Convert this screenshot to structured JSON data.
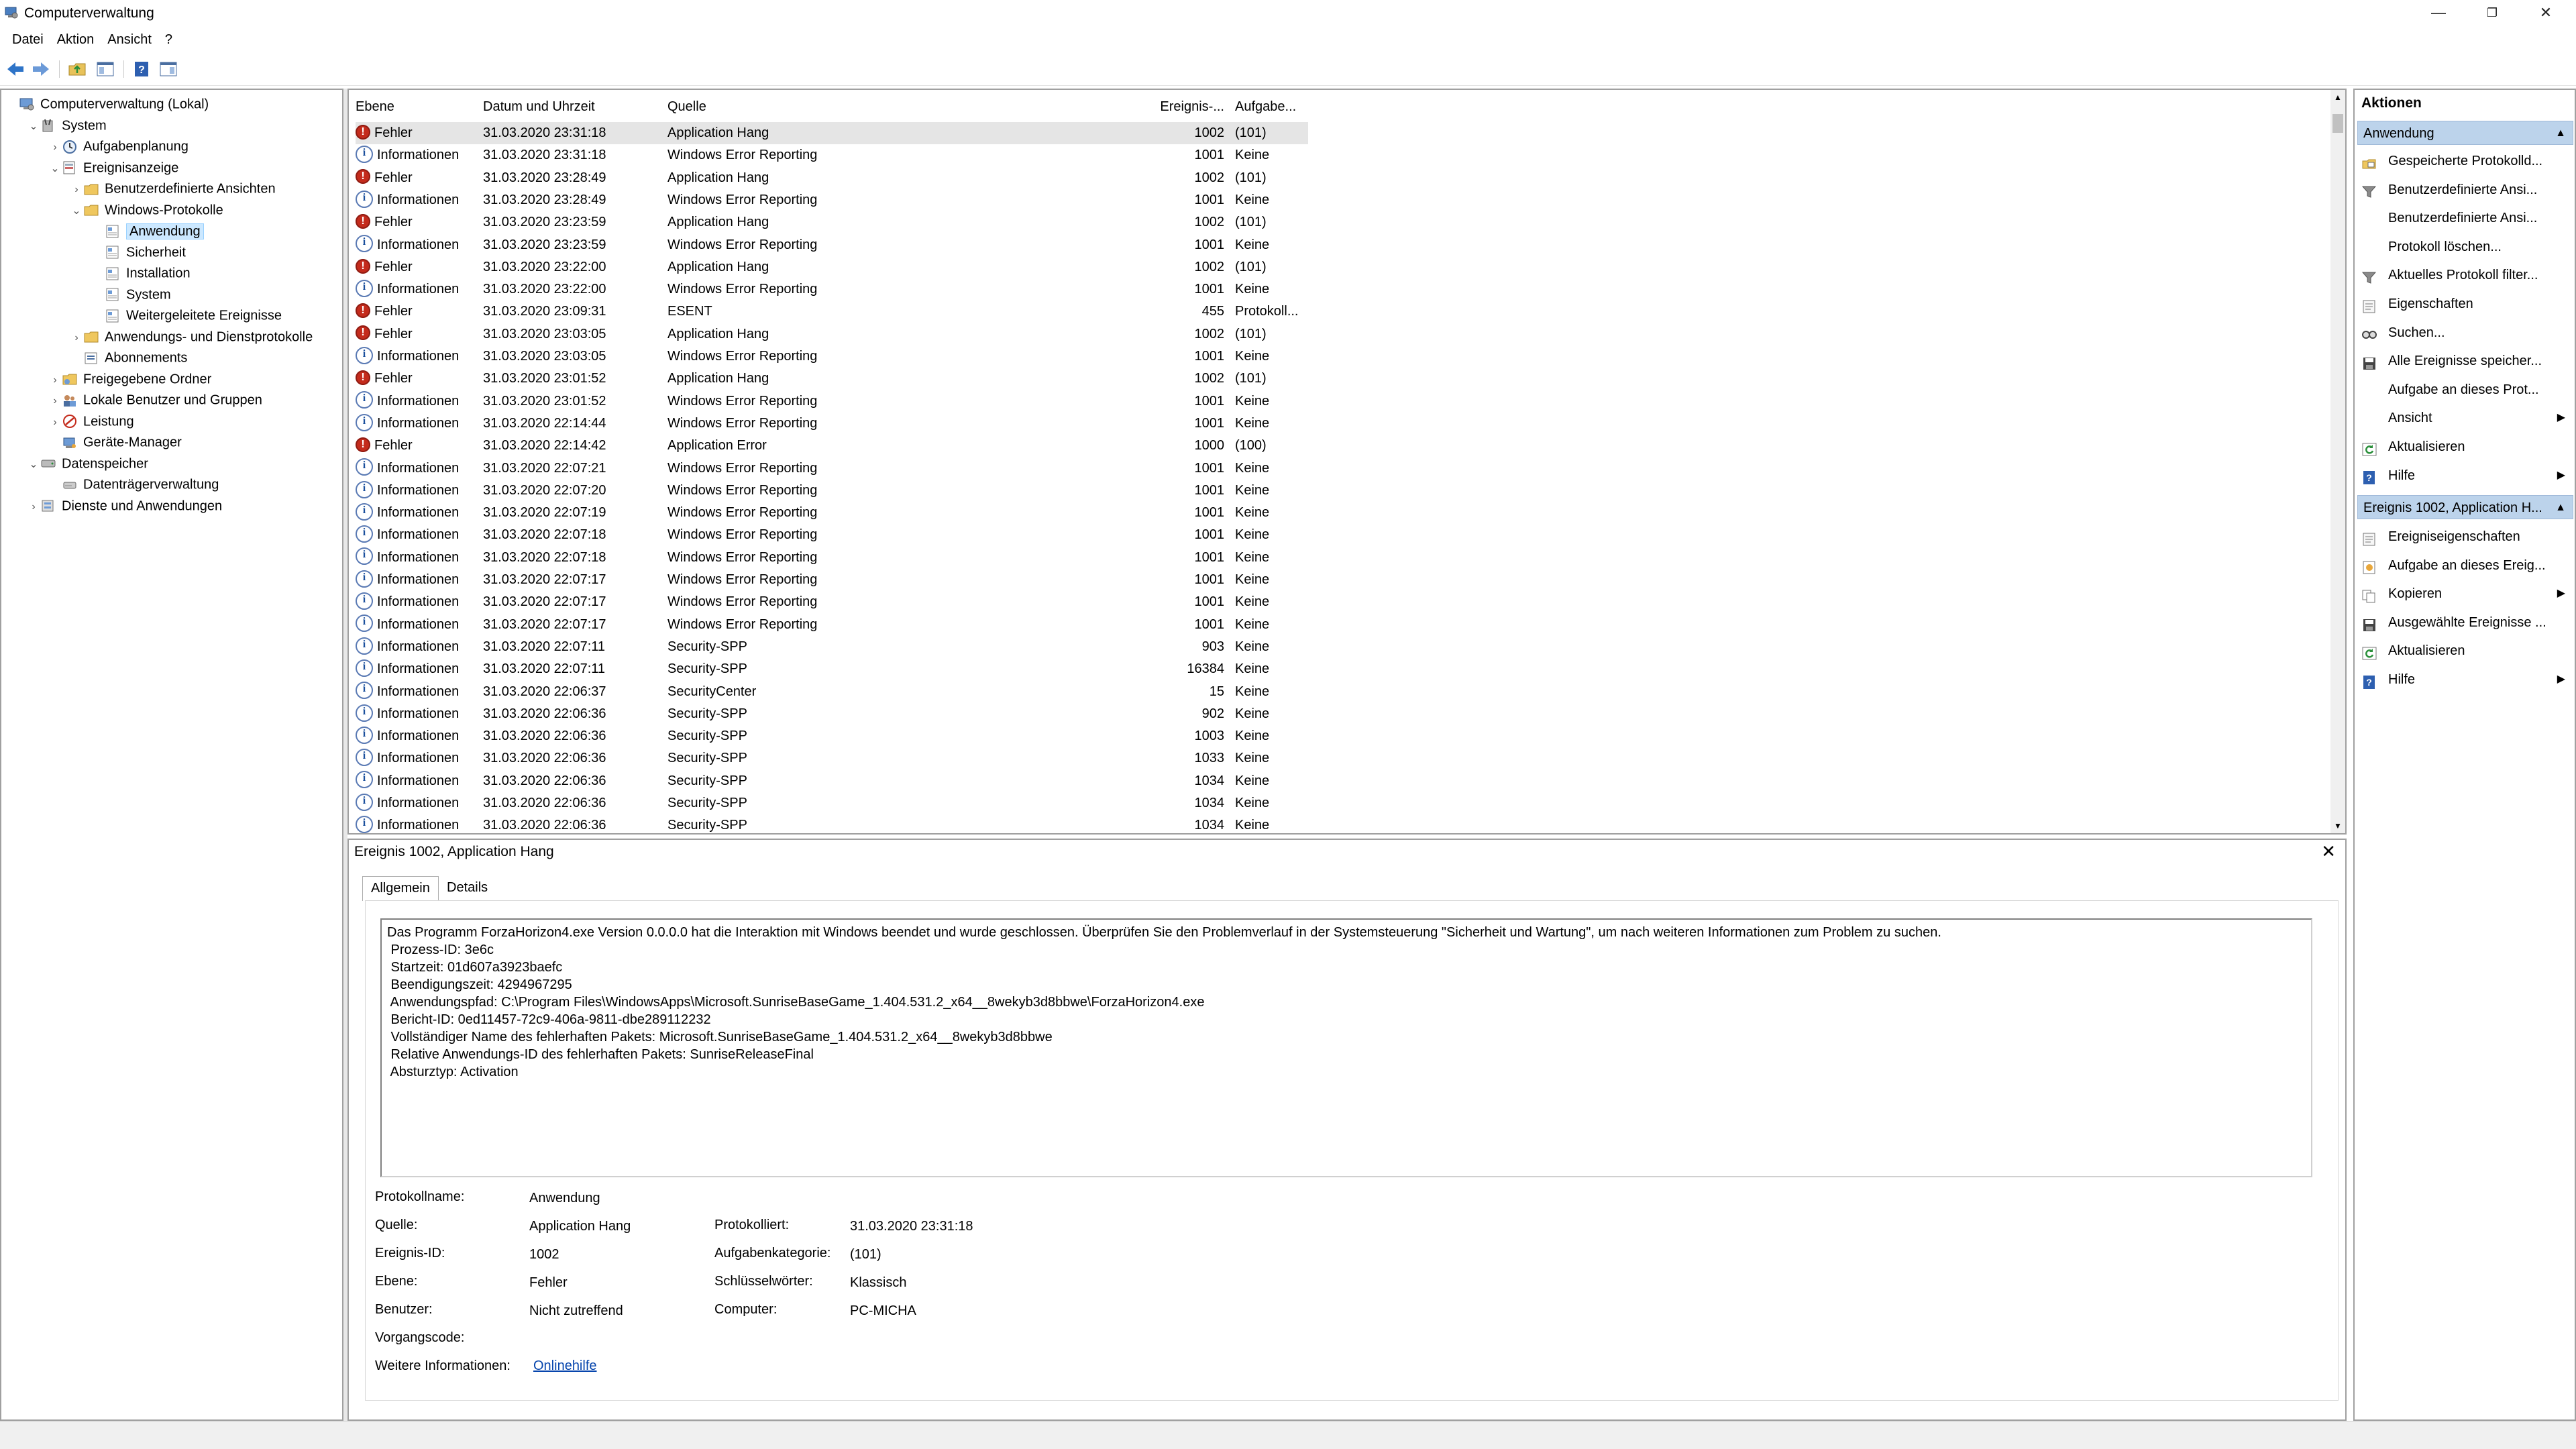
{
  "window": {
    "title": "Computerverwaltung",
    "minimize": "—",
    "restore": "❐",
    "close": "✕"
  },
  "menu": [
    "Datei",
    "Aktion",
    "Ansicht",
    "?"
  ],
  "tree": [
    {
      "label": "Computerverwaltung (Lokal)",
      "exp": "",
      "icon": "computer-icon"
    },
    {
      "label": "System",
      "exp": "⌄",
      "icon": "system-tools-icon"
    },
    {
      "label": "Aufgabenplanung",
      "exp": "›",
      "icon": "clock-icon"
    },
    {
      "label": "Ereignisanzeige",
      "exp": "⌄",
      "icon": "event-viewer-icon"
    },
    {
      "label": "Benutzerdefinierte Ansichten",
      "exp": "›",
      "icon": "folder-icon"
    },
    {
      "label": "Windows-Protokolle",
      "exp": "⌄",
      "icon": "folder-icon"
    },
    {
      "label": "Anwendung",
      "exp": "",
      "icon": "log-icon",
      "selected": true
    },
    {
      "label": "Sicherheit",
      "exp": "",
      "icon": "log-icon"
    },
    {
      "label": "Installation",
      "exp": "",
      "icon": "log-icon"
    },
    {
      "label": "System",
      "exp": "",
      "icon": "log-icon"
    },
    {
      "label": "Weitergeleitete Ereignisse",
      "exp": "",
      "icon": "log-icon"
    },
    {
      "label": "Anwendungs- und Dienstprotokolle",
      "exp": "›",
      "icon": "folder-icon"
    },
    {
      "label": "Abonnements",
      "exp": "",
      "icon": "subscription-icon"
    },
    {
      "label": "Freigegebene Ordner",
      "exp": "›",
      "icon": "shared-folder-icon"
    },
    {
      "label": "Lokale Benutzer und Gruppen",
      "exp": "›",
      "icon": "users-icon"
    },
    {
      "label": "Leistung",
      "exp": "›",
      "icon": "performance-icon"
    },
    {
      "label": "Geräte-Manager",
      "exp": "",
      "icon": "device-manager-icon"
    },
    {
      "label": "Datenspeicher",
      "exp": "⌄",
      "icon": "storage-icon"
    },
    {
      "label": "Datenträgerverwaltung",
      "exp": "",
      "icon": "disk-icon"
    },
    {
      "label": "Dienste und Anwendungen",
      "exp": "›",
      "icon": "services-icon"
    }
  ],
  "list": {
    "headers": [
      "Ebene",
      "Datum und Uhrzeit",
      "Quelle",
      "Ereignis-...",
      "Aufgabe..."
    ],
    "rows": [
      [
        "err",
        "Fehler",
        "31.03.2020 23:31:18",
        "Application Hang",
        "1002",
        "(101)"
      ],
      [
        "info",
        "Informationen",
        "31.03.2020 23:31:18",
        "Windows Error Reporting",
        "1001",
        "Keine"
      ],
      [
        "err",
        "Fehler",
        "31.03.2020 23:28:49",
        "Application Hang",
        "1002",
        "(101)"
      ],
      [
        "info",
        "Informationen",
        "31.03.2020 23:28:49",
        "Windows Error Reporting",
        "1001",
        "Keine"
      ],
      [
        "err",
        "Fehler",
        "31.03.2020 23:23:59",
        "Application Hang",
        "1002",
        "(101)"
      ],
      [
        "info",
        "Informationen",
        "31.03.2020 23:23:59",
        "Windows Error Reporting",
        "1001",
        "Keine"
      ],
      [
        "err",
        "Fehler",
        "31.03.2020 23:22:00",
        "Application Hang",
        "1002",
        "(101)"
      ],
      [
        "info",
        "Informationen",
        "31.03.2020 23:22:00",
        "Windows Error Reporting",
        "1001",
        "Keine"
      ],
      [
        "err",
        "Fehler",
        "31.03.2020 23:09:31",
        "ESENT",
        "455",
        "Protokoll..."
      ],
      [
        "err",
        "Fehler",
        "31.03.2020 23:03:05",
        "Application Hang",
        "1002",
        "(101)"
      ],
      [
        "info",
        "Informationen",
        "31.03.2020 23:03:05",
        "Windows Error Reporting",
        "1001",
        "Keine"
      ],
      [
        "err",
        "Fehler",
        "31.03.2020 23:01:52",
        "Application Hang",
        "1002",
        "(101)"
      ],
      [
        "info",
        "Informationen",
        "31.03.2020 23:01:52",
        "Windows Error Reporting",
        "1001",
        "Keine"
      ],
      [
        "info",
        "Informationen",
        "31.03.2020 22:14:44",
        "Windows Error Reporting",
        "1001",
        "Keine"
      ],
      [
        "err",
        "Fehler",
        "31.03.2020 22:14:42",
        "Application Error",
        "1000",
        "(100)"
      ],
      [
        "info",
        "Informationen",
        "31.03.2020 22:07:21",
        "Windows Error Reporting",
        "1001",
        "Keine"
      ],
      [
        "info",
        "Informationen",
        "31.03.2020 22:07:20",
        "Windows Error Reporting",
        "1001",
        "Keine"
      ],
      [
        "info",
        "Informationen",
        "31.03.2020 22:07:19",
        "Windows Error Reporting",
        "1001",
        "Keine"
      ],
      [
        "info",
        "Informationen",
        "31.03.2020 22:07:18",
        "Windows Error Reporting",
        "1001",
        "Keine"
      ],
      [
        "info",
        "Informationen",
        "31.03.2020 22:07:18",
        "Windows Error Reporting",
        "1001",
        "Keine"
      ],
      [
        "info",
        "Informationen",
        "31.03.2020 22:07:17",
        "Windows Error Reporting",
        "1001",
        "Keine"
      ],
      [
        "info",
        "Informationen",
        "31.03.2020 22:07:17",
        "Windows Error Reporting",
        "1001",
        "Keine"
      ],
      [
        "info",
        "Informationen",
        "31.03.2020 22:07:17",
        "Windows Error Reporting",
        "1001",
        "Keine"
      ],
      [
        "info",
        "Informationen",
        "31.03.2020 22:07:11",
        "Security-SPP",
        "903",
        "Keine"
      ],
      [
        "info",
        "Informationen",
        "31.03.2020 22:07:11",
        "Security-SPP",
        "16384",
        "Keine"
      ],
      [
        "info",
        "Informationen",
        "31.03.2020 22:06:37",
        "SecurityCenter",
        "15",
        "Keine"
      ],
      [
        "info",
        "Informationen",
        "31.03.2020 22:06:36",
        "Security-SPP",
        "902",
        "Keine"
      ],
      [
        "info",
        "Informationen",
        "31.03.2020 22:06:36",
        "Security-SPP",
        "1003",
        "Keine"
      ],
      [
        "info",
        "Informationen",
        "31.03.2020 22:06:36",
        "Security-SPP",
        "1033",
        "Keine"
      ],
      [
        "info",
        "Informationen",
        "31.03.2020 22:06:36",
        "Security-SPP",
        "1034",
        "Keine"
      ],
      [
        "info",
        "Informationen",
        "31.03.2020 22:06:36",
        "Security-SPP",
        "1034",
        "Keine"
      ],
      [
        "info",
        "Informationen",
        "31.03.2020 22:06:36",
        "Security-SPP",
        "1034",
        "Keine"
      ]
    ]
  },
  "detail": {
    "title": "Ereignis 1002, Application Hang",
    "close": "✕",
    "tabs": [
      "Allgemein",
      "Details"
    ],
    "description": "Das Programm ForzaHorizon4.exe Version 0.0.0.0 hat die Interaktion mit Windows beendet und wurde geschlossen. Überprüfen Sie den Problemverlauf in der Systemsteuerung \"Sicherheit und Wartung\", um nach weiteren Informationen zum Problem zu suchen.\n Prozess-ID: 3e6c\n Startzeit: 01d607a3923baefc\n Beendigungszeit: 4294967295\n Anwendungspfad: C:\\Program Files\\WindowsApps\\Microsoft.SunriseBaseGame_1.404.531.2_x64__8wekyb3d8bbwe\\ForzaHorizon4.exe\n Bericht-ID: 0ed11457-72c9-406a-9811-dbe289112232\n Vollständiger Name des fehlerhaften Pakets: Microsoft.SunriseBaseGame_1.404.531.2_x64__8wekyb3d8bbwe\n Relative Anwendungs-ID des fehlerhaften Pakets: SunriseReleaseFinal\n Absturztyp: Activation",
    "props": {
      "protokollname_label": "Protokollname:",
      "protokollname": "Anwendung",
      "quelle_label": "Quelle:",
      "quelle": "Application Hang",
      "protokolliert_label": "Protokolliert:",
      "protokolliert": "31.03.2020 23:31:18",
      "ereignisid_label": "Ereignis-ID:",
      "ereignisid": "1002",
      "aufgabenkategorie_label": "Aufgabenkategorie:",
      "aufgabenkategorie": "(101)",
      "ebene_label": "Ebene:",
      "ebene": "Fehler",
      "schluesselwoerter_label": "Schlüsselwörter:",
      "schluesselwoerter": "Klassisch",
      "benutzer_label": "Benutzer:",
      "benutzer": "Nicht zutreffend",
      "computer_label": "Computer:",
      "computer": "PC-MICHA",
      "vorgangscode_label": "Vorgangscode:",
      "vorgangscode": "",
      "weitere_label": "Weitere Informationen:",
      "weitere_link": "Onlinehilfe"
    }
  },
  "actions": {
    "title": "Aktionen",
    "section1": "Anwendung",
    "items1": [
      {
        "label": "Gespeicherte Protokolld...",
        "icon": "open-log-icon",
        "arrow": ""
      },
      {
        "label": "Benutzerdefinierte Ansi...",
        "icon": "filter-icon",
        "arrow": ""
      },
      {
        "label": "Benutzerdefinierte Ansi...",
        "icon": "",
        "arrow": ""
      },
      {
        "label": "Protokoll löschen...",
        "icon": "",
        "arrow": ""
      },
      {
        "label": "Aktuelles Protokoll filter...",
        "icon": "filter-icon",
        "arrow": ""
      },
      {
        "label": "Eigenschaften",
        "icon": "properties-icon",
        "arrow": ""
      },
      {
        "label": "Suchen...",
        "icon": "find-icon",
        "arrow": ""
      },
      {
        "label": "Alle Ereignisse speicher...",
        "icon": "save-icon",
        "arrow": ""
      },
      {
        "label": "Aufgabe an dieses Prot...",
        "icon": "",
        "arrow": ""
      },
      {
        "label": "Ansicht",
        "icon": "",
        "arrow": "▶"
      },
      {
        "label": "Aktualisieren",
        "icon": "refresh-icon",
        "arrow": ""
      },
      {
        "label": "Hilfe",
        "icon": "help-icon",
        "arrow": "▶"
      }
    ],
    "section2": "Ereignis 1002, Application H...",
    "items2": [
      {
        "label": "Ereigniseigenschaften",
        "icon": "properties-icon",
        "arrow": ""
      },
      {
        "label": "Aufgabe an dieses Ereig...",
        "icon": "task-icon",
        "arrow": ""
      },
      {
        "label": "Kopieren",
        "icon": "copy-icon",
        "arrow": "▶"
      },
      {
        "label": "Ausgewählte Ereignisse ...",
        "icon": "save-icon",
        "arrow": ""
      },
      {
        "label": "Aktualisieren",
        "icon": "refresh-icon",
        "arrow": ""
      },
      {
        "label": "Hilfe",
        "icon": "help-icon",
        "arrow": "▶"
      }
    ]
  }
}
